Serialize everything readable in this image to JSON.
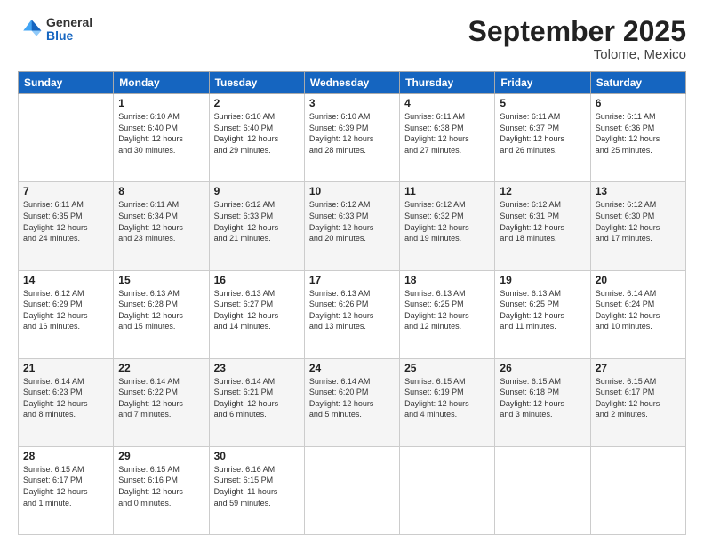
{
  "header": {
    "logo_general": "General",
    "logo_blue": "Blue",
    "title": "September 2025",
    "location": "Tolome, Mexico"
  },
  "days_of_week": [
    "Sunday",
    "Monday",
    "Tuesday",
    "Wednesday",
    "Thursday",
    "Friday",
    "Saturday"
  ],
  "weeks": [
    [
      {
        "num": "",
        "info": ""
      },
      {
        "num": "1",
        "info": "Sunrise: 6:10 AM\nSunset: 6:40 PM\nDaylight: 12 hours\nand 30 minutes."
      },
      {
        "num": "2",
        "info": "Sunrise: 6:10 AM\nSunset: 6:40 PM\nDaylight: 12 hours\nand 29 minutes."
      },
      {
        "num": "3",
        "info": "Sunrise: 6:10 AM\nSunset: 6:39 PM\nDaylight: 12 hours\nand 28 minutes."
      },
      {
        "num": "4",
        "info": "Sunrise: 6:11 AM\nSunset: 6:38 PM\nDaylight: 12 hours\nand 27 minutes."
      },
      {
        "num": "5",
        "info": "Sunrise: 6:11 AM\nSunset: 6:37 PM\nDaylight: 12 hours\nand 26 minutes."
      },
      {
        "num": "6",
        "info": "Sunrise: 6:11 AM\nSunset: 6:36 PM\nDaylight: 12 hours\nand 25 minutes."
      }
    ],
    [
      {
        "num": "7",
        "info": "Sunrise: 6:11 AM\nSunset: 6:35 PM\nDaylight: 12 hours\nand 24 minutes."
      },
      {
        "num": "8",
        "info": "Sunrise: 6:11 AM\nSunset: 6:34 PM\nDaylight: 12 hours\nand 23 minutes."
      },
      {
        "num": "9",
        "info": "Sunrise: 6:12 AM\nSunset: 6:33 PM\nDaylight: 12 hours\nand 21 minutes."
      },
      {
        "num": "10",
        "info": "Sunrise: 6:12 AM\nSunset: 6:33 PM\nDaylight: 12 hours\nand 20 minutes."
      },
      {
        "num": "11",
        "info": "Sunrise: 6:12 AM\nSunset: 6:32 PM\nDaylight: 12 hours\nand 19 minutes."
      },
      {
        "num": "12",
        "info": "Sunrise: 6:12 AM\nSunset: 6:31 PM\nDaylight: 12 hours\nand 18 minutes."
      },
      {
        "num": "13",
        "info": "Sunrise: 6:12 AM\nSunset: 6:30 PM\nDaylight: 12 hours\nand 17 minutes."
      }
    ],
    [
      {
        "num": "14",
        "info": "Sunrise: 6:12 AM\nSunset: 6:29 PM\nDaylight: 12 hours\nand 16 minutes."
      },
      {
        "num": "15",
        "info": "Sunrise: 6:13 AM\nSunset: 6:28 PM\nDaylight: 12 hours\nand 15 minutes."
      },
      {
        "num": "16",
        "info": "Sunrise: 6:13 AM\nSunset: 6:27 PM\nDaylight: 12 hours\nand 14 minutes."
      },
      {
        "num": "17",
        "info": "Sunrise: 6:13 AM\nSunset: 6:26 PM\nDaylight: 12 hours\nand 13 minutes."
      },
      {
        "num": "18",
        "info": "Sunrise: 6:13 AM\nSunset: 6:25 PM\nDaylight: 12 hours\nand 12 minutes."
      },
      {
        "num": "19",
        "info": "Sunrise: 6:13 AM\nSunset: 6:25 PM\nDaylight: 12 hours\nand 11 minutes."
      },
      {
        "num": "20",
        "info": "Sunrise: 6:14 AM\nSunset: 6:24 PM\nDaylight: 12 hours\nand 10 minutes."
      }
    ],
    [
      {
        "num": "21",
        "info": "Sunrise: 6:14 AM\nSunset: 6:23 PM\nDaylight: 12 hours\nand 8 minutes."
      },
      {
        "num": "22",
        "info": "Sunrise: 6:14 AM\nSunset: 6:22 PM\nDaylight: 12 hours\nand 7 minutes."
      },
      {
        "num": "23",
        "info": "Sunrise: 6:14 AM\nSunset: 6:21 PM\nDaylight: 12 hours\nand 6 minutes."
      },
      {
        "num": "24",
        "info": "Sunrise: 6:14 AM\nSunset: 6:20 PM\nDaylight: 12 hours\nand 5 minutes."
      },
      {
        "num": "25",
        "info": "Sunrise: 6:15 AM\nSunset: 6:19 PM\nDaylight: 12 hours\nand 4 minutes."
      },
      {
        "num": "26",
        "info": "Sunrise: 6:15 AM\nSunset: 6:18 PM\nDaylight: 12 hours\nand 3 minutes."
      },
      {
        "num": "27",
        "info": "Sunrise: 6:15 AM\nSunset: 6:17 PM\nDaylight: 12 hours\nand 2 minutes."
      }
    ],
    [
      {
        "num": "28",
        "info": "Sunrise: 6:15 AM\nSunset: 6:17 PM\nDaylight: 12 hours\nand 1 minute."
      },
      {
        "num": "29",
        "info": "Sunrise: 6:15 AM\nSunset: 6:16 PM\nDaylight: 12 hours\nand 0 minutes."
      },
      {
        "num": "30",
        "info": "Sunrise: 6:16 AM\nSunset: 6:15 PM\nDaylight: 11 hours\nand 59 minutes."
      },
      {
        "num": "",
        "info": ""
      },
      {
        "num": "",
        "info": ""
      },
      {
        "num": "",
        "info": ""
      },
      {
        "num": "",
        "info": ""
      }
    ]
  ]
}
